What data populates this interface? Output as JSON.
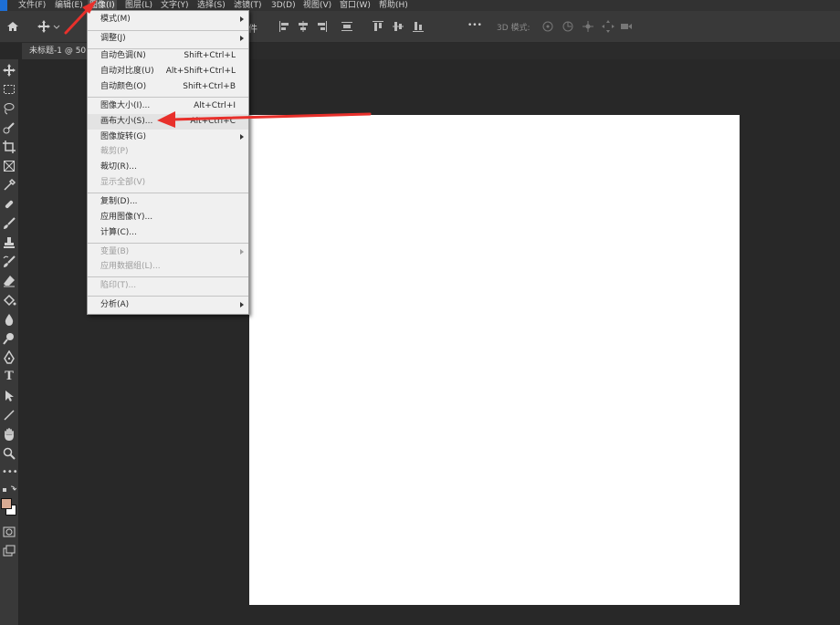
{
  "menubar": {
    "items": [
      "文件(F)",
      "编辑(E)",
      "图像(I)",
      "图层(L)",
      "文字(Y)",
      "选择(S)",
      "滤镜(T)",
      "3D(D)",
      "视图(V)",
      "窗口(W)",
      "帮助(H)"
    ]
  },
  "optionsbar": {
    "fragment": "件",
    "mode_label": "3D 模式:",
    "more": "•••"
  },
  "document": {
    "tab_title": "未标题-1 @ 50"
  },
  "image_menu": {
    "mode": "模式(M)",
    "adjust": "调整(J)",
    "auto_tone": "自动色调(N)",
    "auto_tone_sc": "Shift+Ctrl+L",
    "auto_contrast": "自动对比度(U)",
    "auto_contrast_sc": "Alt+Shift+Ctrl+L",
    "auto_color": "自动颜色(O)",
    "auto_color_sc": "Shift+Ctrl+B",
    "image_size": "图像大小(I)...",
    "image_size_sc": "Alt+Ctrl+I",
    "canvas_size": "画布大小(S)...",
    "canvas_size_sc": "Alt+Ctrl+C",
    "image_rotation": "图像旋转(G)",
    "crop": "裁剪(P)",
    "trim": "裁切(R)...",
    "reveal_all": "显示全部(V)",
    "duplicate": "复制(D)...",
    "apply_image": "应用图像(Y)...",
    "calculations": "计算(C)...",
    "variables": "变量(B)",
    "apply_dataset": "应用数据组(L)...",
    "trap": "陷印(T)...",
    "analysis": "分析(A)"
  },
  "colors": {
    "foreground": "#d9ab93",
    "background": "#ffffff",
    "annotation": "#e8302b"
  }
}
